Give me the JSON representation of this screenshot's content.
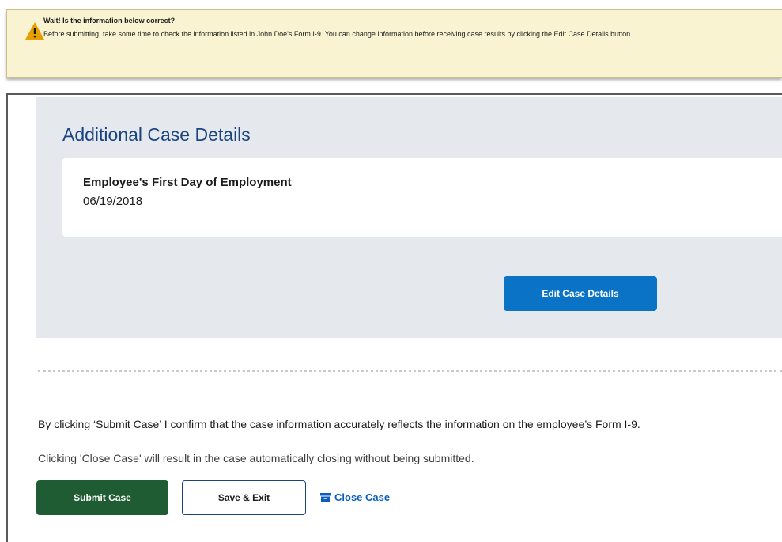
{
  "alert": {
    "icon": "warning-triangle-icon",
    "title": "Wait! Is the information below correct?",
    "body": "Before submitting, take some time to check the information listed in John Doe's Form I-9. You can change information before receiving case results by clicking the Edit Case Details button."
  },
  "details": {
    "heading": "Additional Case Details",
    "field_label": "Employee's First Day of Employment",
    "field_value": "06/19/2018",
    "edit_button": "Edit Case Details"
  },
  "confirmation": {
    "text": "By clicking ‘Submit Case’ I confirm that the case information accurately reflects the information on the employee’s Form I-9.",
    "close_note": "Clicking 'Close Case' will result in the case automatically closing without being submitted."
  },
  "actions": {
    "submit_label": "Submit Case",
    "save_label": "Save & Exit",
    "close_label": "Close Case",
    "close_icon": "archive-box-icon"
  },
  "colors": {
    "alert_bg": "#faf3d1",
    "warning": "#e5a000",
    "heading": "#1a4480",
    "primary_button": "#0b73c6",
    "submit_button": "#1f5c34",
    "link": "#0b5ebd",
    "panel_bg": "#e5e8ec"
  }
}
